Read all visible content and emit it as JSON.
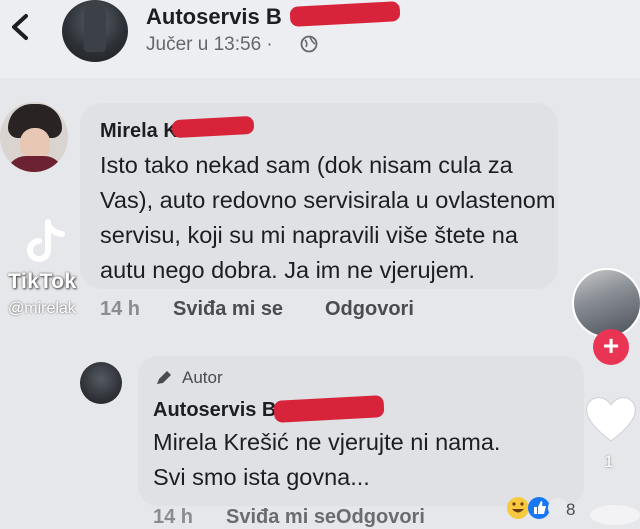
{
  "post": {
    "author": "Autoservis B",
    "time": "Jučer u 13:56 ·"
  },
  "comment": {
    "author": "Mirela K",
    "lines": [
      "Isto tako nekad sam (dok nisam cula za",
      "Vas), auto redovno servisirala u ovlastenom",
      "servisu, koji su mi napravili više štete na",
      "autu nego dobra. Ja im ne vjerujem."
    ],
    "time": "14 h",
    "like_label": "Sviđa mi se",
    "reply_label": "Odgovori"
  },
  "reply": {
    "badge": "Autor",
    "author": "Autoservis B",
    "lines": [
      "Mirela Krešić ne vjerujte ni nama.",
      "Svi smo ista govna..."
    ],
    "reaction_count": "8",
    "time": "14 h",
    "like_label": "Sviđa mi se",
    "reply_label": "Odgovori"
  },
  "tiktok": {
    "wordmark": "TikTok",
    "username": "@mirelak",
    "like_count": "1"
  },
  "colors": {
    "accent": "#ea3454",
    "redaction": "#d8243a",
    "bubble": "#dfe1e5"
  }
}
